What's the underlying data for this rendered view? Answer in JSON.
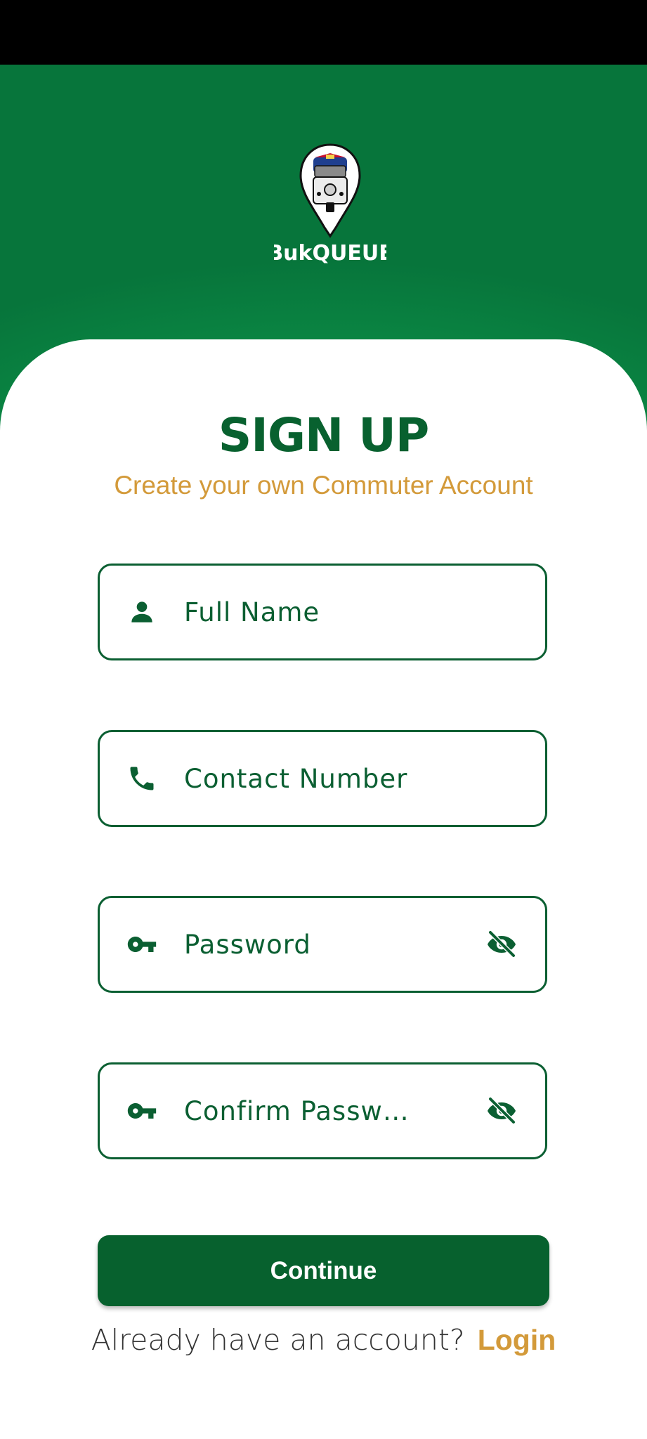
{
  "brand": {
    "app_name": "BukQUEUE"
  },
  "header": {
    "title": "SIGN UP",
    "subtitle": "Create your own Commuter Account"
  },
  "form": {
    "fields": [
      {
        "icon": "person-icon",
        "placeholder": "Full Name",
        "value": ""
      },
      {
        "icon": "phone-icon",
        "placeholder": "Contact Number",
        "value": ""
      },
      {
        "icon": "key-icon",
        "placeholder": "Password",
        "value": "",
        "trailing_icon": "eye-off-icon"
      },
      {
        "icon": "key-icon",
        "placeholder": "Confirm Passw…",
        "value": "",
        "trailing_icon": "eye-off-icon"
      }
    ],
    "submit_label": "Continue"
  },
  "footer": {
    "prompt": "Already have an account?",
    "login_label": "Login"
  },
  "colors": {
    "primary_green": "#07612e",
    "accent_orange": "#d39a3a",
    "hero_green": "#0b8a45"
  }
}
